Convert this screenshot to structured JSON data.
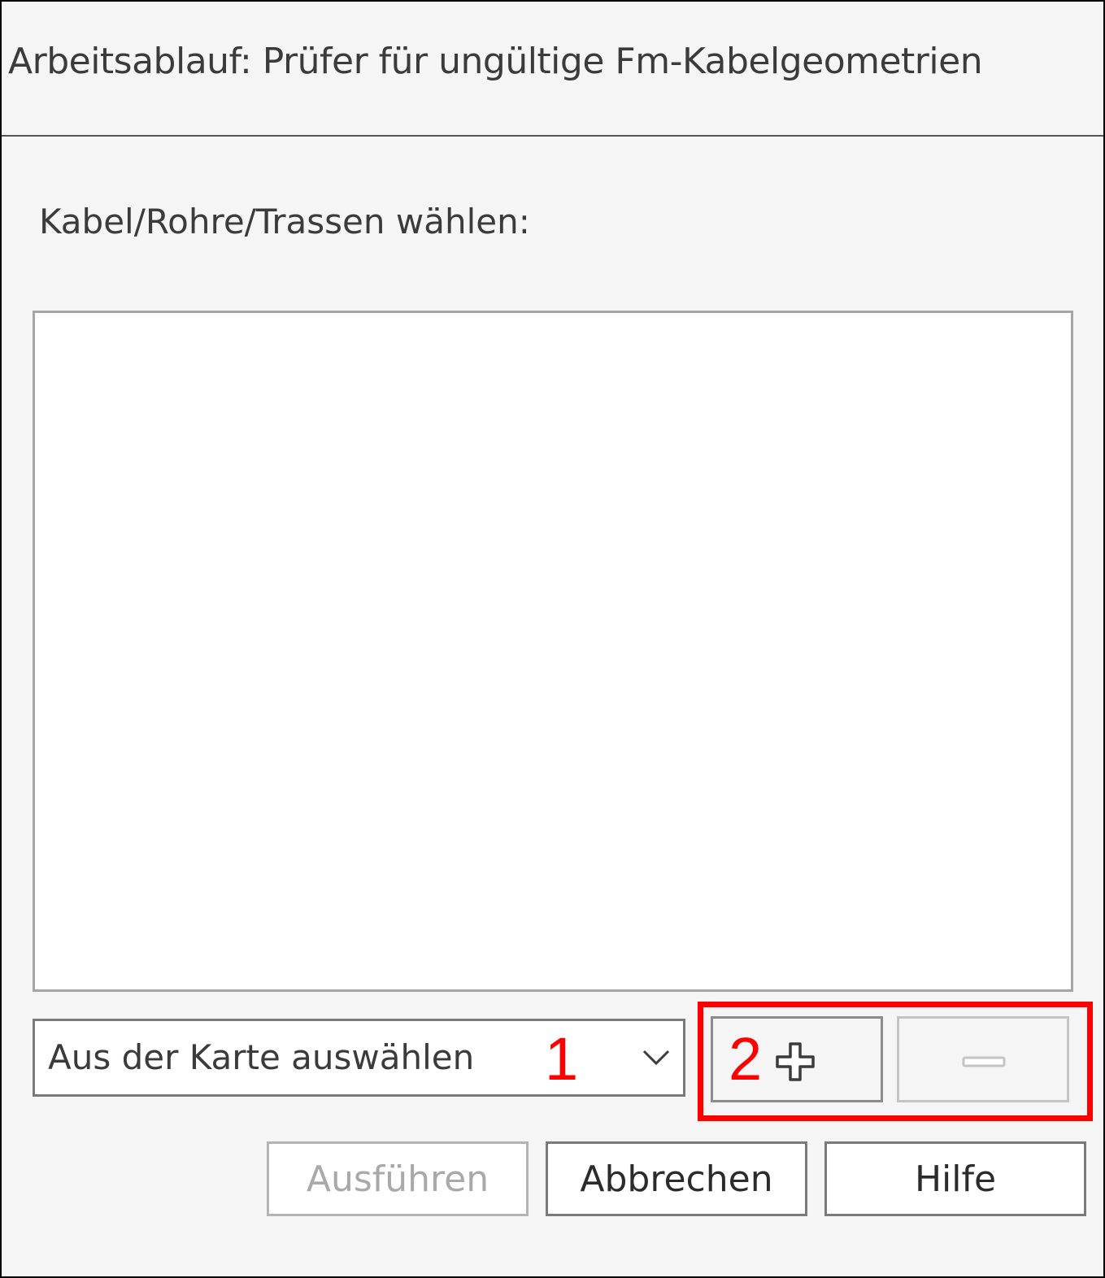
{
  "window": {
    "title": "Arbeitsablauf: Prüfer für ungültige Fm-Kabelgeometrien"
  },
  "selection": {
    "label": "Kabel/Rohre/Trassen wählen:",
    "items": []
  },
  "source_dropdown": {
    "selected": "Aus der Karte auswählen"
  },
  "annotations": {
    "marker_1": "1",
    "marker_2": "2",
    "highlight_color": "#ff0000"
  },
  "icons": {
    "add": "plus-icon",
    "remove": "minus-icon",
    "dropdown": "chevron-down-icon"
  },
  "buttons": {
    "run": {
      "label": "Ausführen",
      "enabled": false
    },
    "cancel": {
      "label": "Abbrechen",
      "enabled": true
    },
    "help": {
      "label": "Hilfe",
      "enabled": true
    }
  }
}
